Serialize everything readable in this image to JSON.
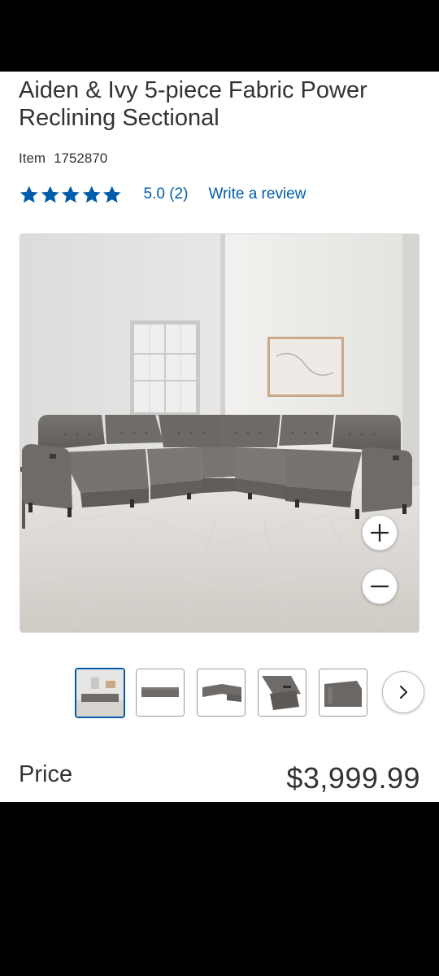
{
  "product": {
    "title": "Aiden & Ivy 5-piece Fabric Power Reclining Sectional",
    "item_label": "Item",
    "item_number": "1752870",
    "rating": {
      "stars": 5,
      "value_text": "5.0",
      "count_text": "(2)"
    },
    "write_review_label": "Write a review"
  },
  "gallery": {
    "main_image": "grey-fabric-sectional-room",
    "zoom_in_icon": "plus-icon",
    "zoom_out_icon": "minus-icon",
    "thumbnails": [
      "sectional-room-view",
      "sectional-front-view",
      "sectional-angle-view",
      "recliner-open-view",
      "sofa-arm-closeup"
    ],
    "selected_thumbnail": 1,
    "next_icon": "chevron-right-icon"
  },
  "price": {
    "label": "Price",
    "value": "$3,999.99"
  },
  "colors": {
    "accent": "#005dab",
    "text": "#333333",
    "star": "#005dab"
  }
}
